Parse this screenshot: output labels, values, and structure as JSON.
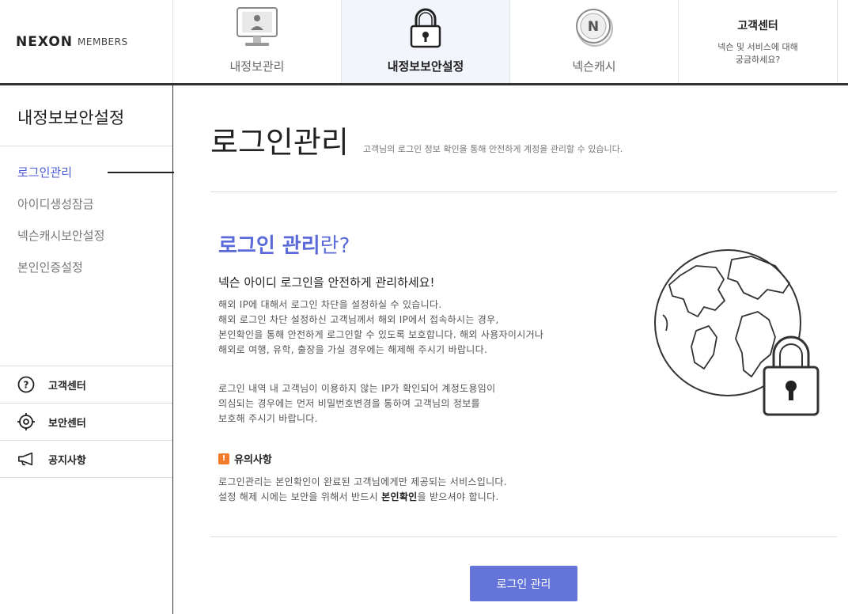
{
  "brand": {
    "main": "NEXON",
    "sub": "MEMBERS"
  },
  "nav": {
    "tabs": [
      {
        "label": "내정보관리",
        "icon": "monitor-user-icon"
      },
      {
        "label": "내정보보안설정",
        "icon": "padlock-icon",
        "active": true
      },
      {
        "label": "넥슨캐시",
        "icon": "nexon-coin-icon",
        "coin_letter": "N"
      }
    ],
    "help": {
      "title": "고객센터",
      "line1": "넥슨 및 서비스에 대해",
      "line2": "궁금하세요?"
    }
  },
  "sidebar": {
    "title": "내정보보안설정",
    "items": [
      {
        "label": "로그인관리",
        "active": true
      },
      {
        "label": "아이디생성잠금"
      },
      {
        "label": "넥슨캐시보안설정"
      },
      {
        "label": "본인인증설정"
      }
    ],
    "links": [
      {
        "label": "고객센터",
        "icon": "question-circle-icon"
      },
      {
        "label": "보안센터",
        "icon": "target-icon"
      },
      {
        "label": "공지사항",
        "icon": "megaphone-icon"
      }
    ]
  },
  "main": {
    "page_title": "로그인관리",
    "page_desc": "고객님의 로그인 정보 확인을 통해 안전하게 계정을 관리할 수 있습니다.",
    "section_title": "로그인 관리",
    "section_title_suffix": "란?",
    "subtitle": "넥슨 아이디 로그인을 안전하게 관리하세요!",
    "para1": [
      "해외 IP에 대해서 로그인 차단을 설정하실 수 있습니다.",
      "해외 로그인 차단 설정하신 고객님께서 해외 IP에서 접속하시는 경우,",
      "본인확인을 통해 안전하게 로그인할 수 있도록 보호합니다. 해외 사용자이시거나",
      "해외로 여행, 유학, 출장을 가실 경우에는 해제해 주시기 바랍니다."
    ],
    "para2": [
      "로그인 내역 내 고객님이 이용하지 않는 IP가 확인되어 계정도용임이",
      "의심되는 경우에는 먼저 비밀번호변경을 통하여 고객님의 정보를",
      "보호해 주시기 바랍니다."
    ],
    "notice": {
      "badge": "!",
      "title": "유의사항",
      "line1": "로그인관리는 본인확인이 완료된 고객님에게만 제공되는 서비스입니다.",
      "line2_pre": "설정 해제 시에는 보안을 위해서 반드시 ",
      "line2_bold": "본인확인",
      "line2_post": "을 받으셔야 합니다."
    },
    "button": "로그인 관리",
    "illustration_icon": "globe-lock-icon"
  }
}
